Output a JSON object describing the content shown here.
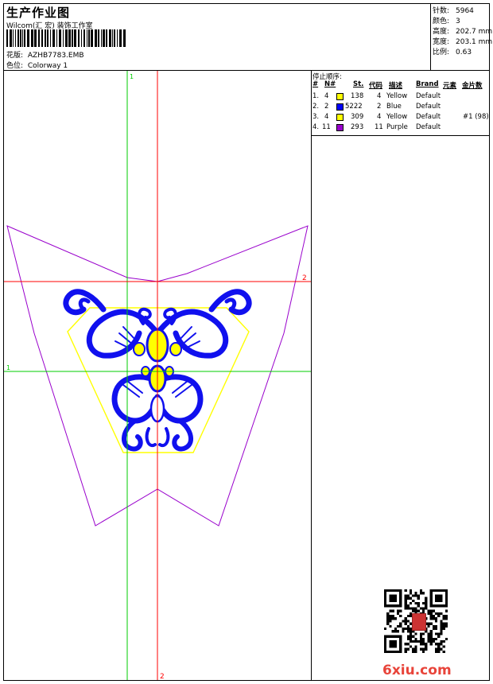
{
  "header": {
    "title": "生产作业图",
    "company": "Wilcom(汇 宏) 装饰工作室",
    "design_label": "花版:",
    "design_value": "AZHB7783.EMB",
    "colorway_label": "色位:",
    "colorway_value": "Colorway 1"
  },
  "stats": [
    {
      "label": "针数:",
      "value": "5964"
    },
    {
      "label": "颜色:",
      "value": "3"
    },
    {
      "label": "高度:",
      "value": "202.7 mm"
    },
    {
      "label": "宽度:",
      "value": "203.1 mm"
    },
    {
      "label": "比例:",
      "value": "0.63"
    }
  ],
  "guides": {
    "green_top_label": "1",
    "green_left_label": "1",
    "red_right_label": "2",
    "red_bottom_label": "2"
  },
  "stop_sequence": {
    "title": "停止顺序:",
    "headers": [
      "#",
      "N#",
      "St.",
      "代码",
      "描述",
      "Brand",
      "元素",
      "金片数"
    ],
    "rows": [
      {
        "idx": "1.",
        "n": "4",
        "color": "#ffff00",
        "st": "138",
        "code": "4",
        "desc": "Yellow",
        "brand": "Default",
        "elem": "",
        "sequin": ""
      },
      {
        "idx": "2.",
        "n": "2",
        "color": "#0000ff",
        "st": "5222",
        "code": "2",
        "desc": "Blue",
        "brand": "Default",
        "elem": "",
        "sequin": ""
      },
      {
        "idx": "3.",
        "n": "4",
        "color": "#ffff00",
        "st": "309",
        "code": "4",
        "desc": "Yellow",
        "brand": "Default",
        "elem": "#1 (98)",
        "sequin": ""
      },
      {
        "idx": "4.",
        "n": "11",
        "color": "#9900cc",
        "st": "293",
        "code": "11",
        "desc": "Purple",
        "brand": "Default",
        "elem": "",
        "sequin": ""
      }
    ]
  },
  "watermark": "6xiu.com",
  "colors": {
    "guide_green": "#00cc00",
    "guide_red": "#ff0000",
    "outline_purple": "#9900cc",
    "embroidery_blue": "#1010ee",
    "fill_yellow": "#ffff00"
  }
}
